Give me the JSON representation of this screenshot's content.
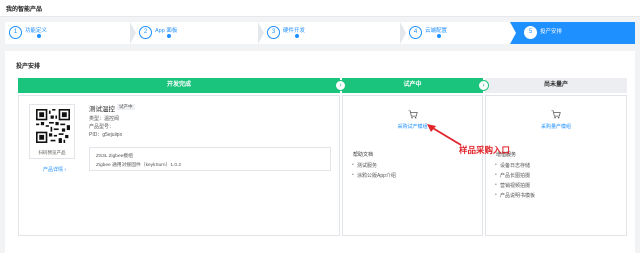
{
  "header": {
    "title": "我的智能产品"
  },
  "steps": [
    {
      "num": "1",
      "label": "功能定义"
    },
    {
      "num": "2",
      "label": "App 面板"
    },
    {
      "num": "3",
      "label": "硬件开发"
    },
    {
      "num": "4",
      "label": "云端配置"
    },
    {
      "num": "5",
      "label": "投产安排"
    }
  ],
  "panel": {
    "title": "投产安排"
  },
  "phases": {
    "done": "开发完成",
    "trial": "试产中",
    "mass": "尚未量产"
  },
  "product": {
    "qr_caption": "扫码预览产品",
    "detail_link": "产品详情 ›",
    "name": "测试温控",
    "status_badge": "试产中",
    "type_line": "类型：温控阀",
    "model_line": "产品型号：",
    "pid_line": "PID：g5ejuiipx",
    "module_line": "ZS3L Zigbee模组",
    "firmware_line": "Zigbee 通用对接固件（keykSurn）1.0.2"
  },
  "trial": {
    "buy_link": "采购试产模组",
    "help_title": "帮助文档",
    "help_items": [
      "测试服务",
      "涂鸦公版App介绍"
    ]
  },
  "mass": {
    "buy_link": "采购量产模组",
    "service_title": "增值服务",
    "service_items": [
      "设备日志存储",
      "产品长图拍摄",
      "营销视频拍摄",
      "产品说明书模板"
    ]
  },
  "annotation": {
    "text": "样品采购入口",
    "color": "#e0242a"
  },
  "colors": {
    "primary": "#1e90ff",
    "green": "#1bc47d"
  },
  "icons": {
    "cart": "cart-icon",
    "qr": "qr-code",
    "chevron": "chevron-right-icon"
  }
}
